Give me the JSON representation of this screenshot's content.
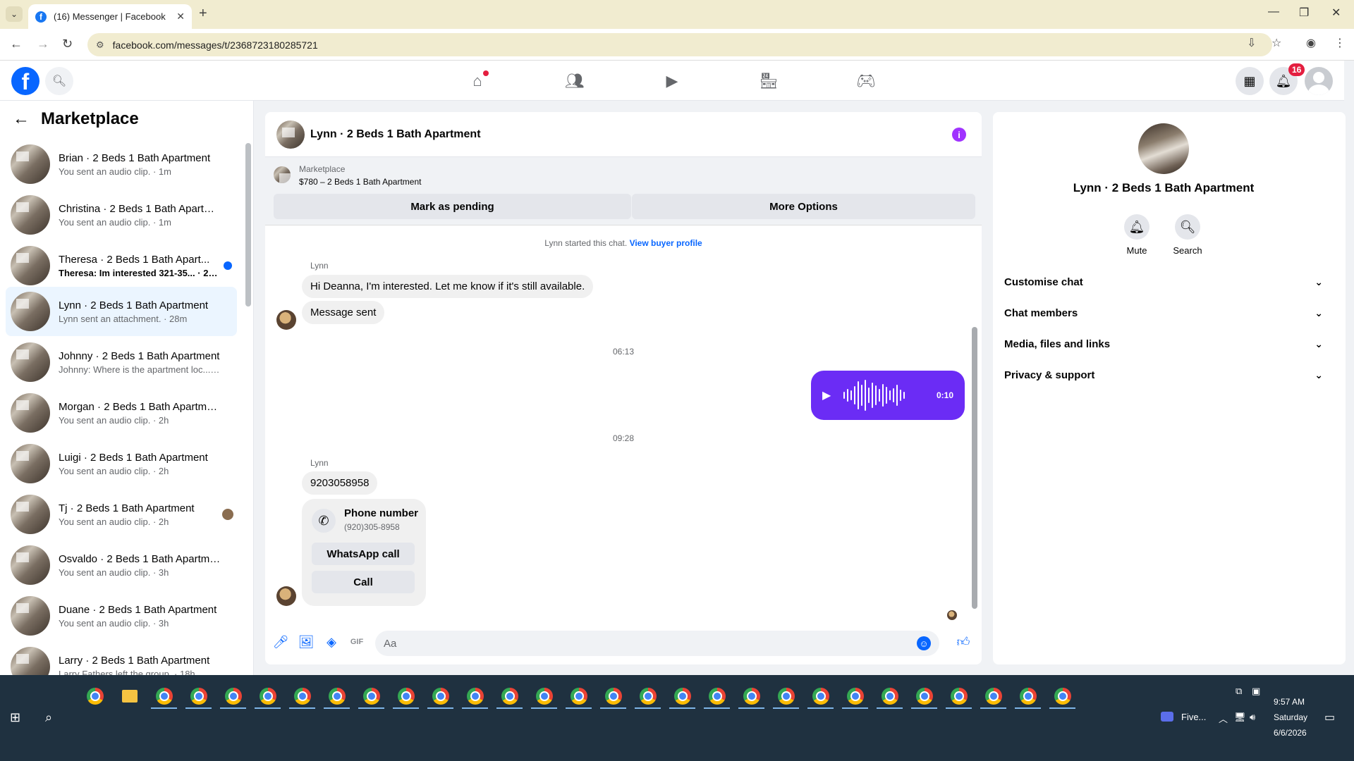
{
  "browser": {
    "tab_title": "(16) Messenger | Facebook",
    "url": "facebook.com/messages/t/2368723180285721"
  },
  "fb_header": {
    "notification_count": "16"
  },
  "sidebar": {
    "title": "Marketplace",
    "conversations": [
      {
        "name": "Brian · 2 Beds 1 Bath Apartment",
        "subtitle": "You sent an audio clip. · 1m",
        "unread": false,
        "active": false
      },
      {
        "name": "Christina · 2 Beds 1 Bath Apartm...",
        "subtitle": "You sent an audio clip. · 1m",
        "unread": false,
        "active": false
      },
      {
        "name": "Theresa · 2 Beds 1 Bath Apart...",
        "subtitle": "Theresa: Im interested 321-35... · 25m",
        "unread": true,
        "active": false
      },
      {
        "name": "Lynn · 2 Beds 1 Bath Apartment",
        "subtitle": "Lynn sent an attachment. · 28m",
        "unread": false,
        "active": true
      },
      {
        "name": "Johnny · 2 Beds 1 Bath Apartment",
        "subtitle": "Johnny: Where is the apartment loc... · 1h",
        "unread": false,
        "active": false
      },
      {
        "name": "Morgan · 2 Beds 1 Bath Apartme...",
        "subtitle": "You sent an audio clip. · 2h",
        "unread": false,
        "active": false
      },
      {
        "name": "Luigi · 2 Beds 1 Bath Apartment",
        "subtitle": "You sent an audio clip. · 2h",
        "unread": false,
        "active": false
      },
      {
        "name": "Tj · 2 Beds 1 Bath Apartment",
        "subtitle": "You sent an audio clip. · 2h",
        "unread": false,
        "active": false
      },
      {
        "name": "Osvaldo · 2 Beds 1 Bath Apartme...",
        "subtitle": "You sent an audio clip. · 3h",
        "unread": false,
        "active": false
      },
      {
        "name": "Duane · 2 Beds 1 Bath Apartment",
        "subtitle": "You sent an audio clip. · 3h",
        "unread": false,
        "active": false
      },
      {
        "name": "Larry · 2 Beds 1 Bath Apartment",
        "subtitle": "Larry Fathers left the group. · 18h",
        "unread": false,
        "active": false
      }
    ]
  },
  "chat": {
    "title": "Lynn · 2 Beds 1 Bath Apartment",
    "marketplace_label": "Marketplace",
    "listing": "$780 – 2 Beds 1 Bath Apartment",
    "mark_pending": "Mark as pending",
    "more_options": "More Options",
    "system_text": "Lynn started this chat.",
    "system_link": "View buyer profile",
    "sender1": "Lynn",
    "msg1": "Hi Deanna, I'm interested. Let me know if it's still available.",
    "msg2": "Message sent",
    "time1": "06:13",
    "audio_duration": "0:10",
    "time2": "09:28",
    "sender2": "Lynn",
    "msg3": "9203058958",
    "phone_card": {
      "title": "Phone number",
      "number": "(920)305-8958",
      "whatsapp": "WhatsApp call",
      "call": "Call"
    },
    "input_placeholder": "Aa"
  },
  "right_panel": {
    "name": "Lynn · 2 Beds 1 Bath Apartment",
    "mute": "Mute",
    "search": "Search",
    "sections": [
      "Customise chat",
      "Chat members",
      "Media, files and links",
      "Privacy & support"
    ]
  },
  "taskbar": {
    "time": "9:57 AM",
    "day": "Saturday",
    "date": "6/6/2026",
    "zoom_label": "Five..."
  }
}
